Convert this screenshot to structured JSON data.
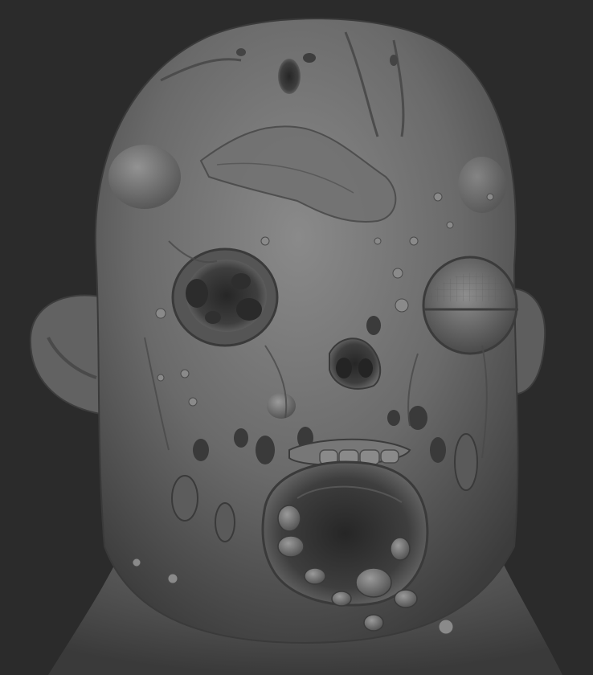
{
  "scene": {
    "subject": "zombie-head-sculpt",
    "background_color": "#2b2b2b",
    "clay_color": "#6e6e6e",
    "clay_shadow": "#3a3a3a",
    "clay_highlight": "#9a9a9a"
  }
}
